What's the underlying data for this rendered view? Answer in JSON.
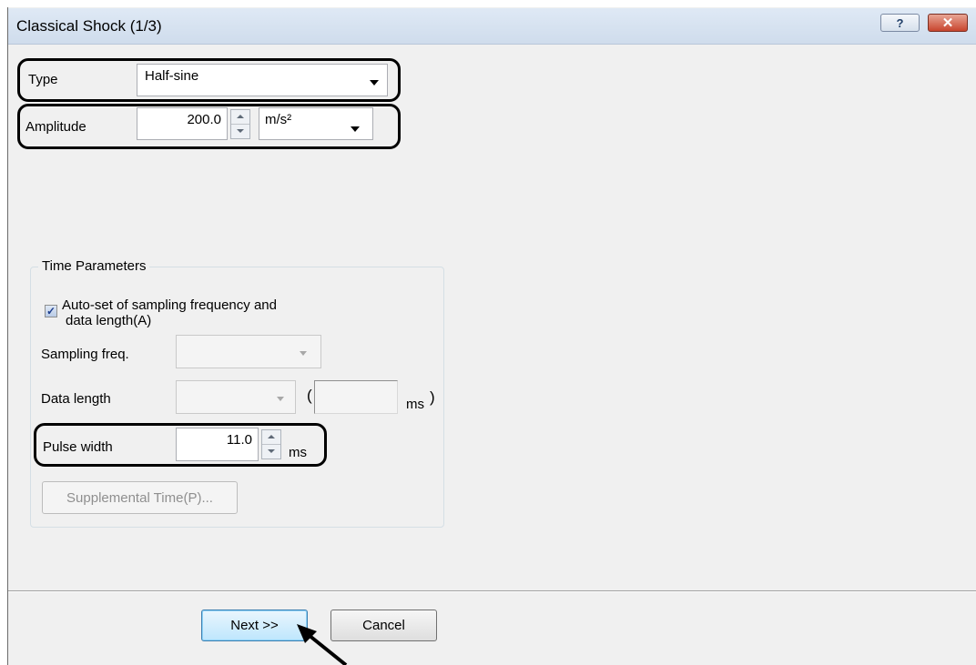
{
  "window": {
    "title": "Classical Shock (1/3)",
    "help_symbol": "?",
    "close_symbol": "✕"
  },
  "type_field": {
    "label": "Type",
    "value": "Half-sine"
  },
  "amplitude_field": {
    "label": "Amplitude",
    "value": "200.0",
    "unit": "m/s²"
  },
  "time_parameters": {
    "group_label": "Time Parameters",
    "auto_set": {
      "label_line1": "Auto-set of sampling frequency and",
      "label_line2": "data length(A)",
      "checked": true
    },
    "sampling_freq": {
      "label": "Sampling freq.",
      "value": ""
    },
    "data_length": {
      "label": "Data length",
      "value": "",
      "paren_open": "(",
      "unit": "ms",
      "paren_close": ")"
    },
    "pulse_width": {
      "label": "Pulse width",
      "value": "11.0",
      "unit": "ms"
    },
    "supplemental_button": "Supplemental Time(P)..."
  },
  "buttons": {
    "next": "Next >>",
    "cancel": "Cancel"
  },
  "icons": {
    "dropdown": "chevron-down-icon",
    "spinner": "spinner-icon",
    "checkmark": "checkmark-icon",
    "annotation_arrow": "arrow-icon"
  },
  "colors": {
    "titlebar": "#d6e2f0",
    "close_button": "#c8452e",
    "default_button": "#bee6fd",
    "annotation_outline": "#000000"
  }
}
